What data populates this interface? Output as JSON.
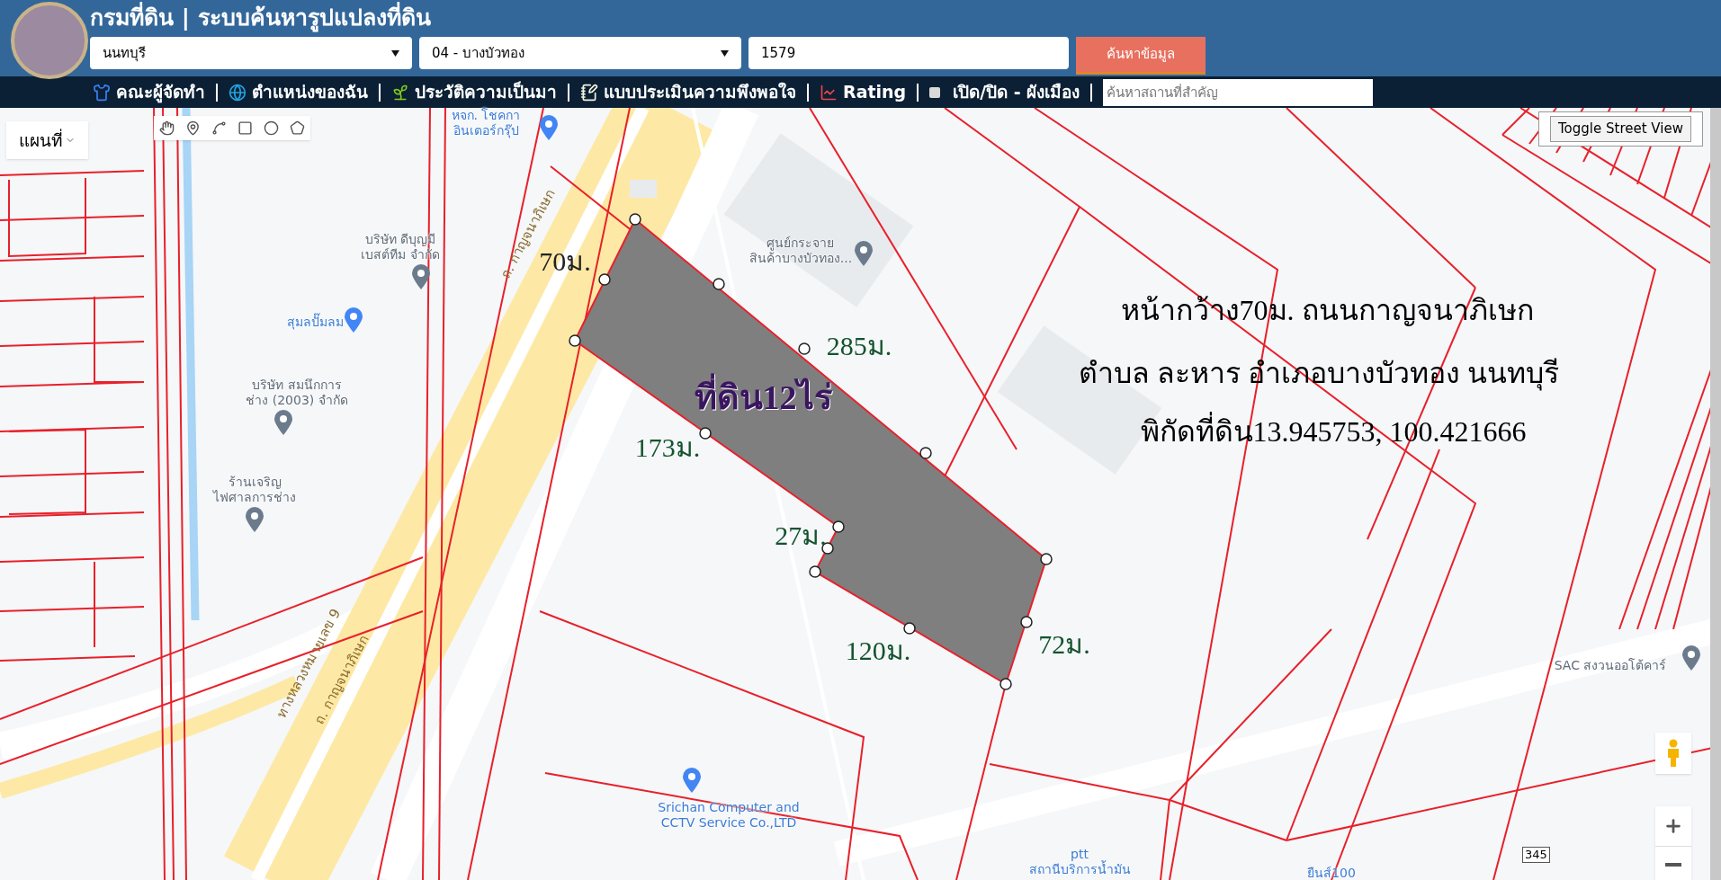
{
  "header": {
    "title": "กรมที่ดิน | ระบบค้นหารูปแปลงที่ดิน",
    "province": {
      "value": "นนทบุรี"
    },
    "district": {
      "value": "04 - บางบัวทอง"
    },
    "parcel_number": {
      "value": "1579"
    },
    "search_button": "ค้นหาข้อมูล"
  },
  "menu": [
    {
      "kind": "link",
      "label": "คณะผู้จัดทำ"
    },
    {
      "kind": "link",
      "label": "ตำแหน่งของฉัน"
    },
    {
      "kind": "link",
      "label": "ประวัติความเป็นมา"
    },
    {
      "kind": "link",
      "label": "แบบประเมินความพึงพอใจ"
    },
    {
      "kind": "link",
      "label": "Rating"
    },
    {
      "kind": "toggle",
      "label": "เปิด/ปิด - ผังเมือง",
      "checked": false
    }
  ],
  "place_search": {
    "placeholder": "ค้นหาสถานที่สำคัญ"
  },
  "map": {
    "map_type": "แผนที่",
    "street_view_button": "Toggle Street View",
    "area_label": "ที่ดิน12ไร่",
    "measurements": [
      "70ม.",
      "285ม.",
      "173ม.",
      "27ม.",
      "120ม.",
      "72ม."
    ],
    "note_lines": [
      "หน้ากว้าง70ม. ถนนกาญจนาภิเษก",
      "ตำบล ละหาร อำเภอบางบัวทอง นนทบุรี",
      "พิกัดที่ดิน13.945753, 100.421666"
    ],
    "places": [
      {
        "kind": "shop",
        "lines": [
          "หจก. โชคกา",
          "อินเตอร์กรุ๊ป"
        ]
      },
      {
        "kind": "business",
        "lines": [
          "บริษัท ดีบุญมี",
          "เบสต์ทีม จำกัด"
        ]
      },
      {
        "kind": "shop",
        "lines": [
          "สุมลปั๊มลม"
        ]
      },
      {
        "kind": "business",
        "lines": [
          "บริษัท สมนึกการ",
          "ช่าง (2003) จำกัด"
        ]
      },
      {
        "kind": "business",
        "lines": [
          "ร้านเจริญ",
          "ไฟศาลการช่าง"
        ]
      },
      {
        "kind": "business",
        "lines": [
          "ศูนย์กระจาย",
          "สินค้าบางบัวทอง..."
        ]
      },
      {
        "kind": "shop",
        "lines": [
          "Srichan Computer and",
          "CCTV Service Co.,LTD"
        ]
      },
      {
        "kind": "shop",
        "lines": [
          "ptt",
          "สถานีบริการน้ำมัน"
        ]
      },
      {
        "kind": "business",
        "lines": [
          "SAC สงวนออโต้คาร์"
        ]
      },
      {
        "kind": "shop",
        "lines": [
          "ยืนส์100"
        ]
      }
    ],
    "road_labels": [
      "ถ. กาญจนาภิเษก",
      "ทางหลวงหมายเลข 9",
      "ถ. กาญจนาภิเษก"
    ],
    "route_shield": "345"
  }
}
